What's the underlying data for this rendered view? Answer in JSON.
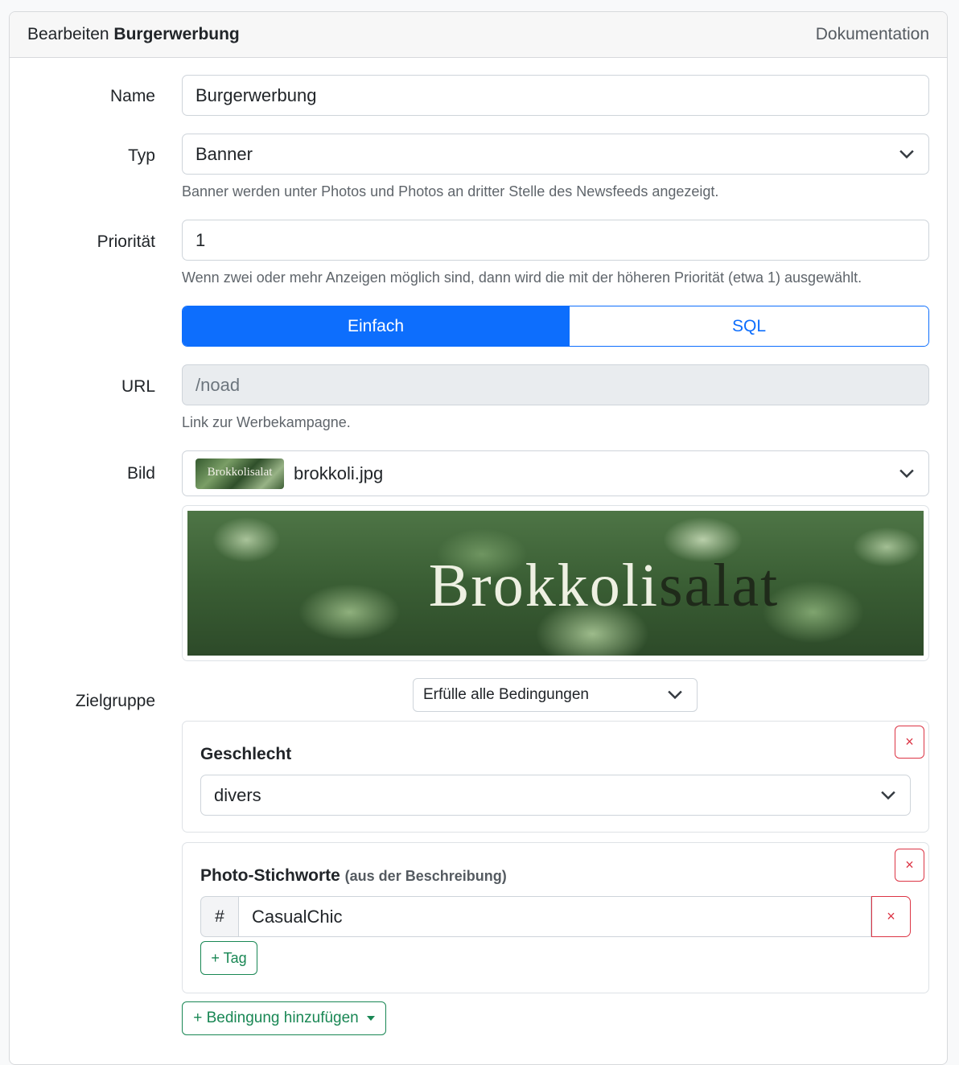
{
  "header": {
    "prefix": "Bearbeiten",
    "name": "Burgerwerbung",
    "doc_link": "Dokumentation"
  },
  "fields": {
    "name": {
      "label": "Name",
      "value": "Burgerwerbung"
    },
    "type": {
      "label": "Typ",
      "value": "Banner",
      "help": "Banner werden unter Photos und Photos an dritter Stelle des Newsfeeds angezeigt."
    },
    "priority": {
      "label": "Priorität",
      "value": "1",
      "help": "Wenn zwei oder mehr Anzeigen möglich sind, dann wird die mit der höheren Priorität (etwa 1) ausgewählt."
    },
    "mode": {
      "options": [
        "Einfach",
        "SQL"
      ],
      "active": "Einfach"
    },
    "url": {
      "label": "URL",
      "placeholder": "/noad",
      "help": "Link zur Werbekampagne."
    },
    "image": {
      "label": "Bild",
      "filename": "brokkoli.jpg",
      "thumb_text": "Brokkolisalat",
      "banner_text_light": "Brokkoli",
      "banner_text_dark": "salat"
    }
  },
  "target": {
    "label": "Zielgruppe",
    "match_mode": "Erfülle alle Bedingungen",
    "conditions": [
      {
        "title": "Geschlecht",
        "value": "divers",
        "remove": "×"
      },
      {
        "title": "Photo-Stichworte",
        "subtitle": "(aus der Beschreibung)",
        "tag_prefix": "#",
        "tag_value": "CasualChic",
        "remove": "×",
        "tag_remove": "×",
        "add_tag": "+ Tag"
      }
    ],
    "add_condition": "+ Bedingung hinzufügen"
  },
  "colors": {
    "primary": "#0d6efd",
    "danger": "#dc3545",
    "success": "#198754"
  }
}
